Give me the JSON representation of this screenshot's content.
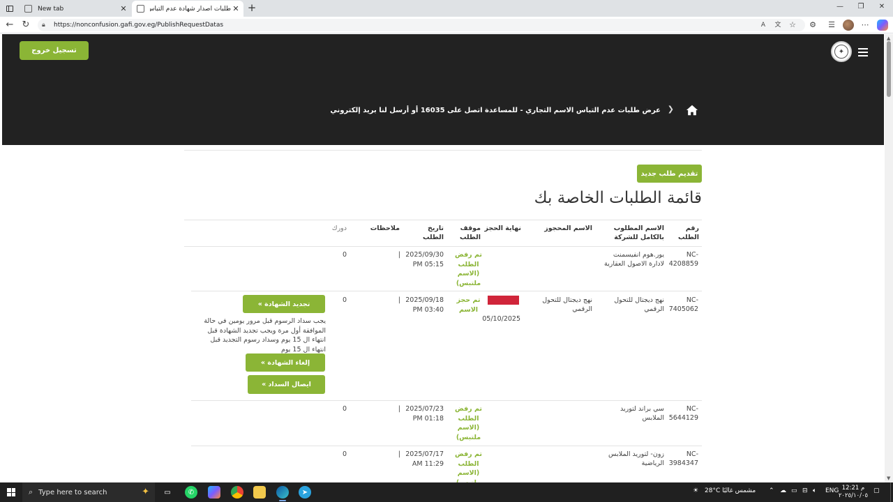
{
  "browser": {
    "tabs": [
      {
        "title": "New tab"
      },
      {
        "title": "طلبات اصدار شهادة عدم التباس الا..."
      }
    ],
    "url": "https://nonconfusion.gafi.gov.eg/PublishRequestDatas"
  },
  "header": {
    "logout_label": "تسجيل خروج",
    "breadcrumb_text": "عرض طلبات عدم التباس الاسم التجاري - للمساعدة اتصل على 16035 أو أرسل لنا بريد إلكتروني"
  },
  "main": {
    "new_request_label": "تقديم طلب جديد",
    "page_title": "قائمة الطلبات الخاصة بك",
    "columns": [
      "رقم الطلب",
      "الاسم المطلوب بالكامل للشركة",
      "الاسم المحجوز",
      "نهاية الحجز",
      "موقف الطلب",
      "تاريخ الطلب",
      "ملاحظات",
      "دورك"
    ],
    "rows": [
      {
        "number": "NC-4208859",
        "requested_name": "يور.هوم انفيسمنت لادارة الاصول العقارية",
        "reserved_name": "",
        "reservation_end": "",
        "status": "تم رفض الطلب (الاسم ملتبس)",
        "date": "2025/09/30",
        "time": "PM 05:15",
        "notes": "|",
        "role": "0"
      },
      {
        "number": "NC-7405062",
        "requested_name": "نهج ديجتال للتحول الرقمي",
        "reserved_name": "نهج ديجتال للتحول الرقمي",
        "reservation_end": "05/10/2025",
        "status": "تم حجز الاسم",
        "date": "2025/09/18",
        "time": "PM 03:40",
        "notes": "|",
        "role": "0",
        "renew_label": "تجديد الشهادة »",
        "note": "يجب سداد الرسوم قبل مرور يومين في حالة الموافقة أول مرة ويجب تجديد الشهادة قبل انتهاء ال 15 يوم وسداد رسوم التجديد قبل انتهاء ال 15 يوم",
        "cancel_label": "إلغاء الشهادة »",
        "receipt_label": "ايصال السداد »"
      },
      {
        "number": "NC-5644129",
        "requested_name": "سي براند لتوريد الملابس",
        "reserved_name": "",
        "reservation_end": "",
        "status": "تم رفض الطلب (الاسم ملتبس)",
        "date": "2025/07/23",
        "time": "PM 01:18",
        "notes": "|",
        "role": "0"
      },
      {
        "number": "NC-3984347",
        "requested_name": "زون- لتوريد الملابس الرياضية",
        "reserved_name": "",
        "reservation_end": "",
        "status": "تم رفض الطلب (الاسم ملتبس)",
        "date": "2025/07/17",
        "time": "AM 11:29",
        "notes": "|",
        "role": "0"
      }
    ]
  },
  "taskbar": {
    "search_placeholder": "Type here to search",
    "weather": "28°C مشمس غالبًا",
    "language": "ENG",
    "time": "12:21 م",
    "date": "٢٠٢٥/١٠/٠٥"
  },
  "colors": {
    "accent": "#8bb536",
    "header_bg": "#222222",
    "reserved_bar": "#d0253a"
  }
}
